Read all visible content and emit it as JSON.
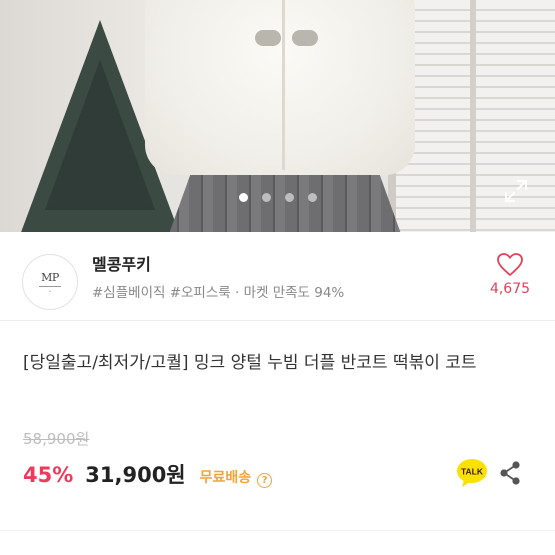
{
  "carousel": {
    "image_alt": "",
    "slide_count": 4,
    "active_index": 0
  },
  "seller": {
    "logo_text": "MP",
    "name": "멜콩푸키",
    "tags": "#심플베이직 #오피스룩 · 마켓 만족도 94%",
    "likes": "4,675"
  },
  "product": {
    "title": "[당일출고/최저가/고퀄] 밍크 양털 누빔 더플 반코트 떡볶이 코트",
    "original_price": "58,900원",
    "discount": "45%",
    "price": "31,900원",
    "shipping": "무료배송",
    "info_icon_text": "?",
    "talk_label": "TALK"
  },
  "colors": {
    "accent_pink": "#ef3b5b",
    "shipping_orange": "#f2a43b",
    "talk_yellow": "#fae100"
  },
  "icons": [
    "expand-icon",
    "heart-icon",
    "kakao-talk-icon",
    "share-icon",
    "info-icon"
  ]
}
